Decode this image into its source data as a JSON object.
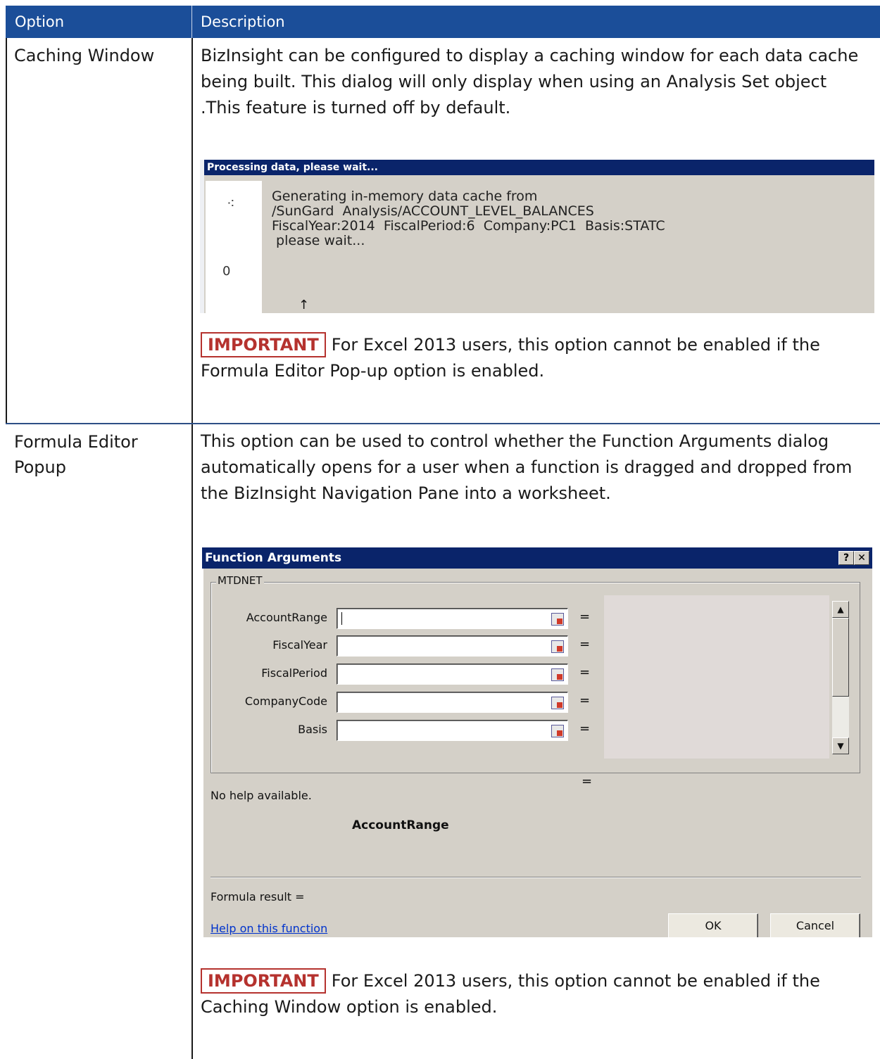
{
  "table": {
    "header": {
      "option": "Option",
      "description": "Description"
    },
    "rows": [
      {
        "option": "Caching Window",
        "description": "BizInsight can be configured to display a caching window for each data cache being built. This dialog will only display when using an Analysis Set object .This feature is turned off by default.",
        "important_label": "IMPORTANT",
        "important_text": "For Excel 2013 users, this option cannot be enabled if the Formula Editor Pop-up option is enabled."
      },
      {
        "option_line1": "Formula Editor",
        "option_line2": "Popup",
        "description": "This option can be used to control whether the Function Arguments dialog automatically opens for a user when a function is dragged and dropped from the BizInsight Navigation Pane into a worksheet.",
        "important_label": "IMPORTANT",
        "important_text": "For Excel 2013 users, this option cannot be enabled if the Caching Window option is enabled."
      }
    ]
  },
  "processing_dialog": {
    "title": "Processing data, please wait...",
    "line1": "Generating in-memory data cache from",
    "line2": "/SunGard  Analysis/ACCOUNT_LEVEL_BALANCES",
    "line3": "FiscalYear:2014  FiscalPeriod:6  Company:PC1  Basis:STATC",
    "line4": " please wait...",
    "counter": "0",
    "cursor_glyph": "↑"
  },
  "function_arguments_dialog": {
    "title": "Function Arguments",
    "help_button": "?",
    "close_button": "✕",
    "function_name": "MTDNET",
    "arguments": [
      {
        "label": "AccountRange",
        "value": ""
      },
      {
        "label": "FiscalYear",
        "value": ""
      },
      {
        "label": "FiscalPeriod",
        "value": ""
      },
      {
        "label": "CompanyCode",
        "value": ""
      },
      {
        "label": "Basis",
        "value": ""
      }
    ],
    "equals": "=",
    "no_help": "No help available.",
    "current_argument": "AccountRange",
    "formula_result": "Formula result =",
    "help_link": "Help on this function",
    "ok_label": "OK",
    "cancel_label": "Cancel",
    "scroll_up": "▲",
    "scroll_down": "▼"
  }
}
